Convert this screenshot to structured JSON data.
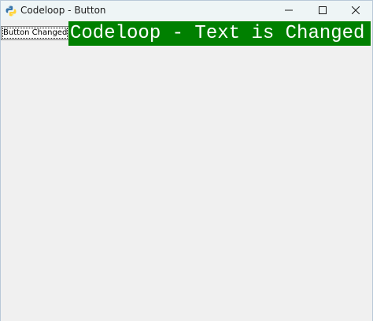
{
  "window": {
    "title": "Codeloop - Button",
    "app_icon": "python-icon",
    "controls": {
      "minimize_icon": "minimize-icon",
      "maximize_icon": "maximize-icon",
      "close_icon": "close-icon"
    }
  },
  "content": {
    "button_label": "Button Changed",
    "label_text": "Codeloop - Text is Changed",
    "label_background": "#008000",
    "label_color": "#ffffff"
  }
}
